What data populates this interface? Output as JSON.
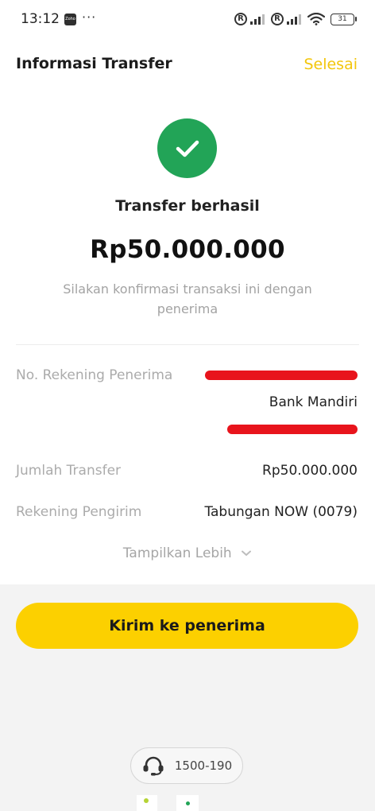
{
  "status_bar": {
    "time": "13:12",
    "app_icon_text": "Zoho",
    "more": "···",
    "roaming_1": "R",
    "roaming_2": "R",
    "battery": "31"
  },
  "header": {
    "title": "Informasi Transfer",
    "done_label": "Selesai"
  },
  "result": {
    "status_icon": "checkmark-icon",
    "title": "Transfer berhasil",
    "amount": "Rp50.000.000",
    "message": "Silakan konfirmasi transaksi ini dengan penerima"
  },
  "details": {
    "recipient_label": "No. Rekening Penerima",
    "recipient_bank": "Bank Mandiri",
    "amount_label": "Jumlah Transfer",
    "amount_value": "Rp50.000.000",
    "sender_label": "Rekening Pengirim",
    "sender_value": "Tabungan NOW (0079)",
    "show_more": "Tampilkan Lebih"
  },
  "actions": {
    "send_label": "Kirim ke penerima"
  },
  "support": {
    "icon": "headset-icon",
    "phone": "1500-190"
  },
  "colors": {
    "accent": "#fcd000",
    "done_text": "#f3c60c",
    "success": "#22a457",
    "redaction": "#e8141c"
  }
}
